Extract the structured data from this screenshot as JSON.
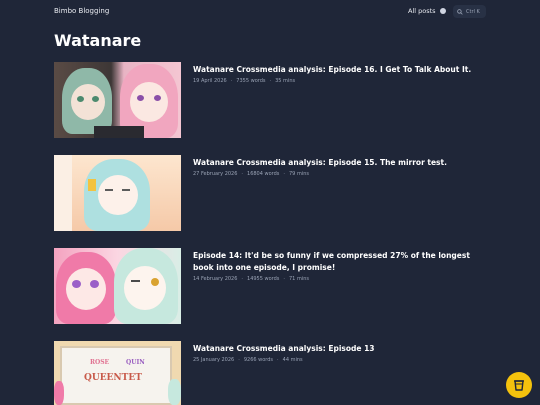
{
  "header": {
    "site_title": "Bimbo Blogging",
    "nav_all_posts": "All posts",
    "search_shortcut": "Ctrl K"
  },
  "page": {
    "title": "Watanare"
  },
  "posts": [
    {
      "title": "Watanare Crossmedia analysis: Episode 16. I Get To Talk About It.",
      "date": "19 April 2026",
      "words": "7355 words",
      "read_time": "35 mins"
    },
    {
      "title": "Watanare Crossmedia analysis: Episode 15. The mirror test.",
      "date": "27 February 2026",
      "words": "16804 words",
      "read_time": "79 mins"
    },
    {
      "title": "Episode 14: It'd be so funny if we compressed 27% of the longest book into one episode, I promise!",
      "date": "14 February 2026",
      "words": "14955 words",
      "read_time": "71 mins"
    },
    {
      "title": "Watanare Crossmedia analysis: Episode 13",
      "date": "25 January 2026",
      "words": "9266 words",
      "read_time": "44 mins"
    }
  ],
  "thumbnail_text": {
    "board_line1_left": "ROSE",
    "board_line1_right": "QUIN",
    "board_line2": "QUEENTET"
  },
  "colors": {
    "background": "#1f2638",
    "accent_fab": "#f4c20d",
    "text_muted": "#9aa3b5"
  },
  "icons": {
    "theme": "circle-icon",
    "search": "search-icon",
    "fab": "coffee-cup-icon"
  }
}
